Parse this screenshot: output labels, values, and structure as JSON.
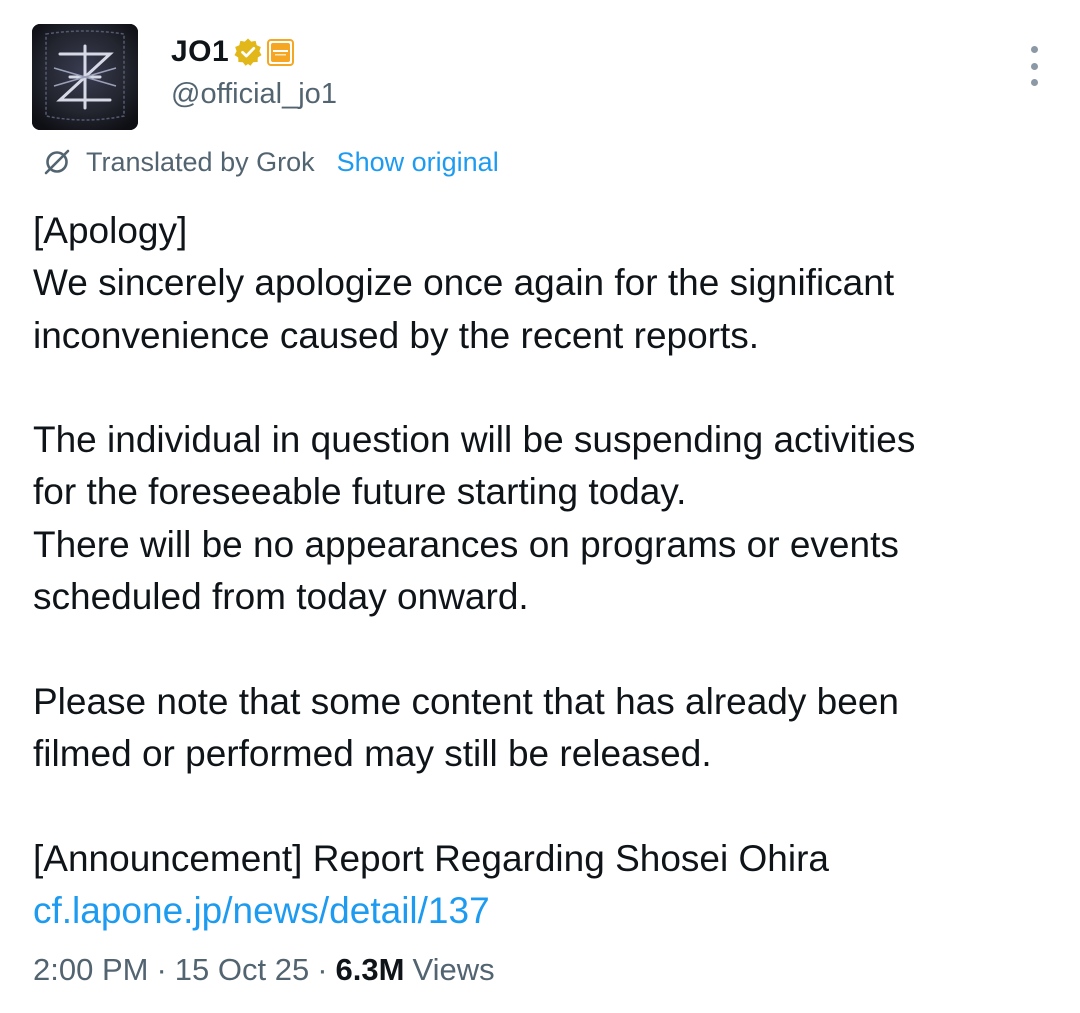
{
  "author": {
    "display_name": "JO1",
    "handle": "@official_jo1",
    "verified_badge_color": "#e2b719",
    "affiliate_badge_color": "#f5a623",
    "avatar_icon": "jo1-logo-avatar",
    "more_icon": "more-options-icon"
  },
  "translation": {
    "icon": "grok-icon",
    "label": "Translated by Grok",
    "action": "Show original"
  },
  "tweet": {
    "paragraphs": [
      [
        "[Apology]",
        "We sincerely apologize once again for the significant",
        "inconvenience caused by the recent reports."
      ],
      [
        "The individual in question will be suspending activities",
        "for the foreseeable future starting today.",
        "There will be no appearances on programs or events",
        "scheduled from today onward."
      ],
      [
        "Please note that some content that has already been",
        "filmed or performed may still be released."
      ],
      [
        "[Announcement] Report Regarding Shosei Ohira"
      ]
    ],
    "link_text": "cf.lapone.jp/news/detail/137"
  },
  "meta": {
    "time": "2:00 PM",
    "separator": "·",
    "date": "15 Oct 25",
    "views_count": "6.3M",
    "views_label": "Views"
  },
  "colors": {
    "link": "#1d9bf0",
    "secondary_text": "#536471",
    "primary_text": "#0f1419"
  }
}
